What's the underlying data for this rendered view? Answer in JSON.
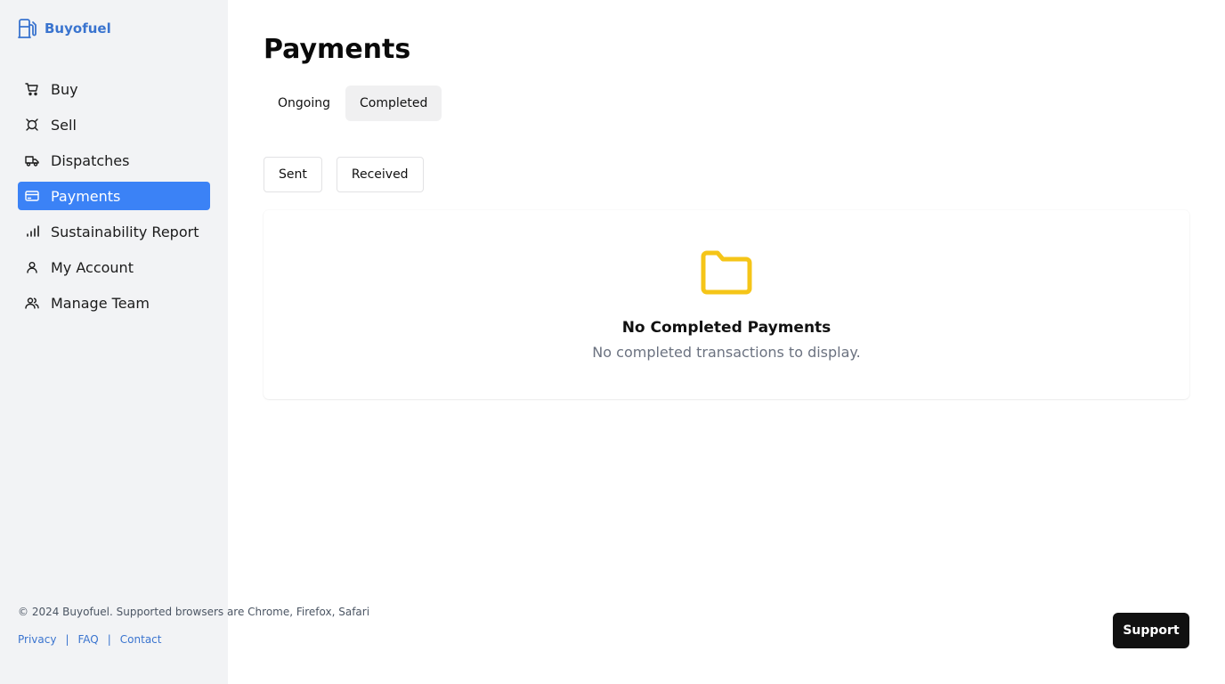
{
  "brand": {
    "name": "Buyofuel",
    "icon": "fuel-pump-icon",
    "color": "#3a74cf"
  },
  "sidebar": {
    "items": [
      {
        "label": "Buy",
        "icon": "cart-icon",
        "active": false
      },
      {
        "label": "Sell",
        "icon": "sell-tag-icon",
        "active": false
      },
      {
        "label": "Dispatches",
        "icon": "truck-icon",
        "active": false
      },
      {
        "label": "Payments",
        "icon": "credit-card-icon",
        "active": true
      },
      {
        "label": "Sustainability Report",
        "icon": "bar-chart-icon",
        "active": false
      },
      {
        "label": "My Account",
        "icon": "user-icon",
        "active": false
      },
      {
        "label": "Manage Team",
        "icon": "users-icon",
        "active": false
      }
    ],
    "active_color": "#3b82f6"
  },
  "main": {
    "title": "Payments",
    "tabs": [
      {
        "label": "Ongoing",
        "active": false
      },
      {
        "label": "Completed",
        "active": true
      }
    ],
    "subtabs": [
      {
        "label": "Sent"
      },
      {
        "label": "Received"
      }
    ],
    "empty_state": {
      "icon": "folder-icon",
      "icon_color": "#f5c518",
      "title": "No Completed Payments",
      "message": "No completed transactions to display."
    }
  },
  "footer": {
    "copyright": "© 2024 Buyofuel. Supported browsers are Chrome, Firefox, Safari",
    "links": [
      "Privacy",
      "FAQ",
      "Contact"
    ],
    "support_label": "Support"
  }
}
